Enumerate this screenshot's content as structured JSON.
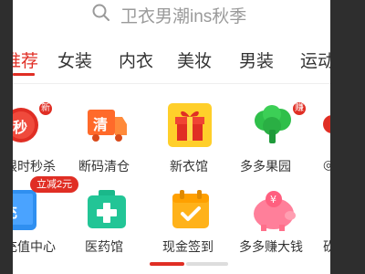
{
  "search": {
    "placeholder": "卫衣男潮ins秋季"
  },
  "tabs": [
    {
      "label": "推荐",
      "active": true
    },
    {
      "label": "女装"
    },
    {
      "label": "内衣"
    },
    {
      "label": "美妆"
    },
    {
      "label": "男装"
    },
    {
      "label": "运动"
    }
  ],
  "row1": [
    {
      "label": "限时秒杀",
      "icon": "flash-sale-icon",
      "icon_text": "秒",
      "badge": "新"
    },
    {
      "label": "断码清仓",
      "icon": "clearance-truck-icon",
      "icon_text": "清"
    },
    {
      "label": "新衣馆",
      "icon": "gift-box-icon"
    },
    {
      "label": "多多果园",
      "icon": "tree-icon",
      "badge": "赚"
    },
    {
      "label": "",
      "icon": "partial-icon"
    }
  ],
  "row2": [
    {
      "label": "充值中心",
      "icon": "recharge-phone-icon",
      "icon_text": "充",
      "pill": "立减2元"
    },
    {
      "label": "医药馆",
      "icon": "medicine-kit-icon"
    },
    {
      "label": "现金签到",
      "icon": "calendar-check-icon"
    },
    {
      "label": "多多赚大钱",
      "icon": "piggy-bank-icon"
    },
    {
      "label": "砍",
      "icon": "partial-icon"
    }
  ],
  "colors": {
    "accent": "#e02e24",
    "text": "#333333",
    "placeholder": "#9a9a9a"
  }
}
